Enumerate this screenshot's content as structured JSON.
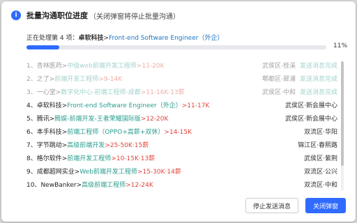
{
  "dialog": {
    "title": "批量沟通职位进度",
    "subtitle": "（关闭弹窗将停止批量沟通）",
    "info_icon": "i"
  },
  "progress": {
    "prefix": "正在处理第 4 项：",
    "company": "卓软科技",
    "separator": ">",
    "position": "Front-end Software Engineer（外企）",
    "percent_label": "11%",
    "fraction": 0.11
  },
  "rows": [
    {
      "index": "1、",
      "company": "杏林医药",
      "sep": ">",
      "position": "中级web前端开发工程师",
      "salary": ">11-20K",
      "location": "武侯区·桂溪",
      "status": "发送消息完成",
      "done": true
    },
    {
      "index": "2、",
      "company": "之了",
      "sep": ">",
      "position": "前端开发工程师",
      "salary": ">9-14K",
      "location": "郫都区·犀浦",
      "status": "发送消息完成",
      "done": true
    },
    {
      "index": "3、",
      "company": "一心堂",
      "sep": ">",
      "position": "数字化中心-前端工程师-成都",
      "salary": ">11-16K·13薪",
      "location": "武侯区·中和",
      "status": "发送消息完成",
      "done": true
    },
    {
      "index": "4、",
      "company": "卓软科技",
      "sep": ">",
      "position": "Front-end Software Engineer（外企）",
      "salary": ">11-17K",
      "location": "武侯区·新会展中心",
      "status": "",
      "done": false
    },
    {
      "index": "5、",
      "company": "腾讯",
      "sep": ">",
      "position": "腾娱-前端开发-王者荣耀国际版",
      "salary": ">12-20K",
      "location": "武侯区·新会展中心",
      "status": "",
      "done": false
    },
    {
      "index": "6、",
      "company": "本手科技",
      "sep": ">",
      "position": "前端工程师（OPPO+高薪+双休）",
      "salary": ">14-15K",
      "location": "双流区·华阳",
      "status": "",
      "done": false
    },
    {
      "index": "7、",
      "company": "字节跳动",
      "sep": ">",
      "position": "高级前端开发",
      "salary": ">25-50K·15薪",
      "location": "锦江区·春熙路",
      "status": "",
      "done": false
    },
    {
      "index": "8、",
      "company": "格尔软件",
      "sep": ">",
      "position": "前端开发工程师",
      "salary": ">10-15K·13薪",
      "location": "武侯区·紫荆",
      "status": "",
      "done": false
    },
    {
      "index": "9、",
      "company": "成都超网实业",
      "sep": ">",
      "position": "Web前端开发工程师",
      "salary": ">15-30K·14薪",
      "location": "双流区·公兴",
      "status": "",
      "done": false
    },
    {
      "index": "10、",
      "company": "NewBanker",
      "sep": ">",
      "position": "高级前端工程师",
      "salary": ">12-24K",
      "location": "双流区·中和",
      "status": "",
      "done": false
    }
  ],
  "buttons": {
    "stop": "停止发送消息",
    "close": "关闭弹窗"
  },
  "colors": {
    "accent": "#2f6bff",
    "position_link": "#2a9d8f",
    "salary": "#e0453a",
    "status_done": "#2a9d8f"
  }
}
